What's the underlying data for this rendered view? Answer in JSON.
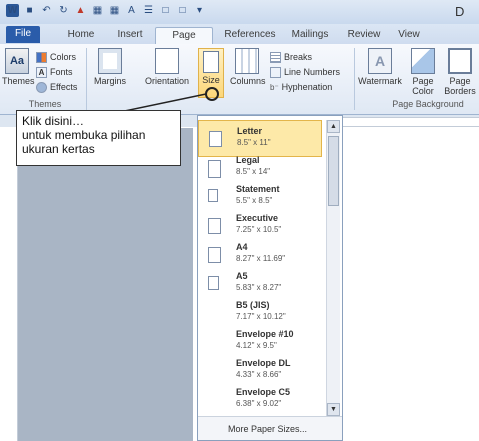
{
  "window": {
    "title_partial": "D"
  },
  "qat": {
    "word_logo": "W",
    "save_icon": "save-icon",
    "undo_icon": "undo-icon",
    "redo_icon": "redo-icon"
  },
  "tabs": [
    {
      "label": "File"
    },
    {
      "label": "Home"
    },
    {
      "label": "Insert"
    },
    {
      "label": "Page Layout"
    },
    {
      "label": "References"
    },
    {
      "label": "Mailings"
    },
    {
      "label": "Review"
    },
    {
      "label": "View"
    }
  ],
  "ribbon": {
    "themes": {
      "themes_label": "Themes",
      "colors_label": "Colors",
      "fonts_label": "Fonts",
      "effects_label": "Effects",
      "group_label": "Themes"
    },
    "page_setup": {
      "margins_label": "Margins",
      "orientation_label": "Orientation",
      "size_label": "Size",
      "columns_label": "Columns",
      "breaks_label": "Breaks",
      "line_numbers_label": "Line Numbers",
      "hyphenation_label": "Hyphenation"
    },
    "page_background": {
      "watermark_label": "Watermark",
      "page_color_label_1": "Page",
      "page_color_label_2": "Color",
      "page_borders_label_1": "Page",
      "page_borders_label_2": "Borders",
      "group_label": "Page Background"
    }
  },
  "callout": {
    "line1": "Klik disini…",
    "line2": "untuk membuka pilihan",
    "line3": "ukuran kertas"
  },
  "size_menu": {
    "items": [
      {
        "name": "Letter",
        "dims": "8.5\" x 11\""
      },
      {
        "name": "Legal",
        "dims": "8.5\" x 14\""
      },
      {
        "name": "Statement",
        "dims": "5.5\" x 8.5\""
      },
      {
        "name": "Executive",
        "dims": "7.25\" x 10.5\""
      },
      {
        "name": "A4",
        "dims": "8.27\" x 11.69\""
      },
      {
        "name": "A5",
        "dims": "5.83\" x 8.27\""
      },
      {
        "name": "B5 (JIS)",
        "dims": "7.17\" x 10.12\""
      },
      {
        "name": "Envelope #10",
        "dims": "4.12\" x 9.5\""
      },
      {
        "name": "Envelope DL",
        "dims": "4.33\" x 8.66\""
      },
      {
        "name": "Envelope C5",
        "dims": "6.38\" x 9.02\""
      }
    ],
    "more": "More Paper Sizes...",
    "selected_index": 0
  }
}
